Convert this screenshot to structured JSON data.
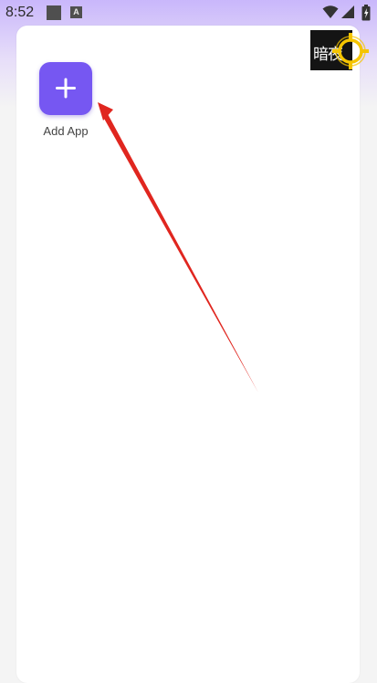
{
  "status_bar": {
    "time": "8:52",
    "notification_icons": [
      "media-icon",
      "a-app-icon"
    ],
    "notification_a_letter": "A",
    "system_icons": [
      "wifi-icon",
      "signal-icon",
      "battery-icon"
    ]
  },
  "launcher": {
    "add_app_label": "Add App",
    "add_app_icon": "plus-icon",
    "accent_color": "#7657f2"
  },
  "logo": {
    "text": "暗夜",
    "ring_color": "#f5c500"
  },
  "annotation": {
    "arrow_color": "#e0261f"
  }
}
